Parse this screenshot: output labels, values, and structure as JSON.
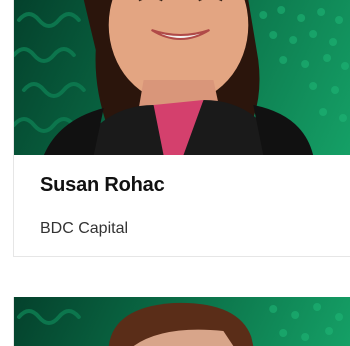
{
  "cards": [
    {
      "name": "Susan Rohac",
      "company": "BDC Capital",
      "photo_icon": "portrait-photo"
    },
    {
      "photo_icon": "portrait-photo"
    }
  ],
  "colors": {
    "photo_bg_dark": "#04412c",
    "photo_bg_light": "#15a066",
    "name_text": "#111111",
    "company_text": "#333333"
  }
}
